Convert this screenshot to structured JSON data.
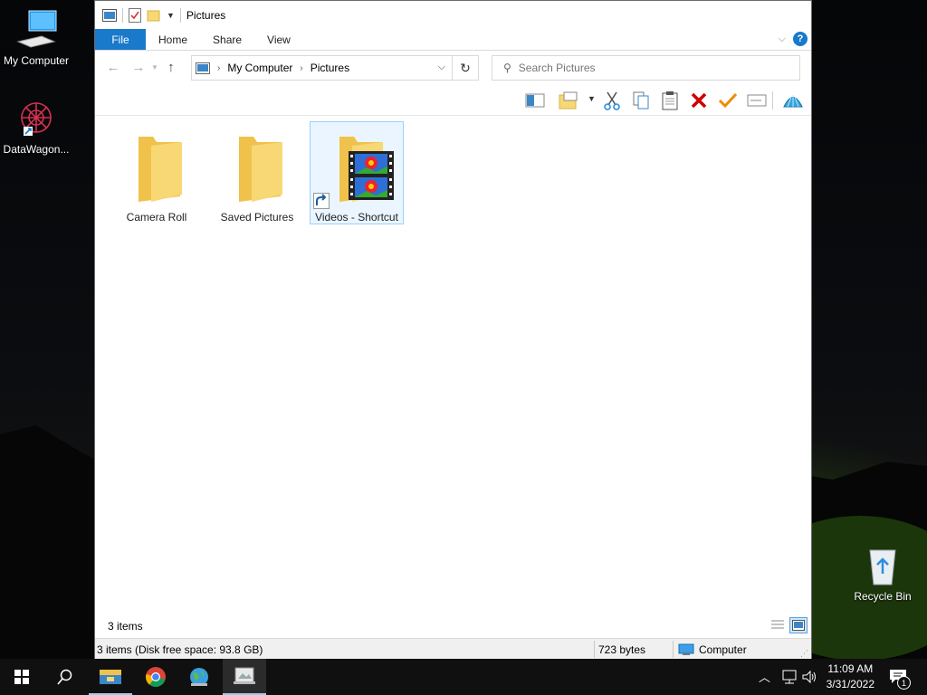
{
  "desktop": {
    "icons": [
      {
        "label": "My Computer"
      },
      {
        "label": "DataWagon..."
      },
      {
        "label": "Recycle Bin"
      }
    ]
  },
  "window": {
    "title": "Pictures",
    "ribbon_tabs": [
      "File",
      "Home",
      "Share",
      "View"
    ],
    "address": {
      "crumbs": [
        "My Computer",
        "Pictures"
      ]
    },
    "search": {
      "placeholder": "Search Pictures"
    },
    "items": [
      {
        "label": "Camera Roll",
        "selected": false
      },
      {
        "label": "Saved Pictures",
        "selected": false
      },
      {
        "label": "Videos - Shortcut",
        "selected": true
      }
    ],
    "status": {
      "item_count": "3 items"
    },
    "details": {
      "summary": "3 items (Disk free space: 93.8 GB)",
      "size": "723 bytes",
      "location": "Computer"
    }
  },
  "taskbar": {
    "time": "11:09 AM",
    "date": "3/31/2022",
    "notification_count": "1"
  },
  "colors": {
    "accent": "#1979ca",
    "folder": "#f8d775",
    "delete": "#d00000",
    "check": "#f08a00"
  }
}
